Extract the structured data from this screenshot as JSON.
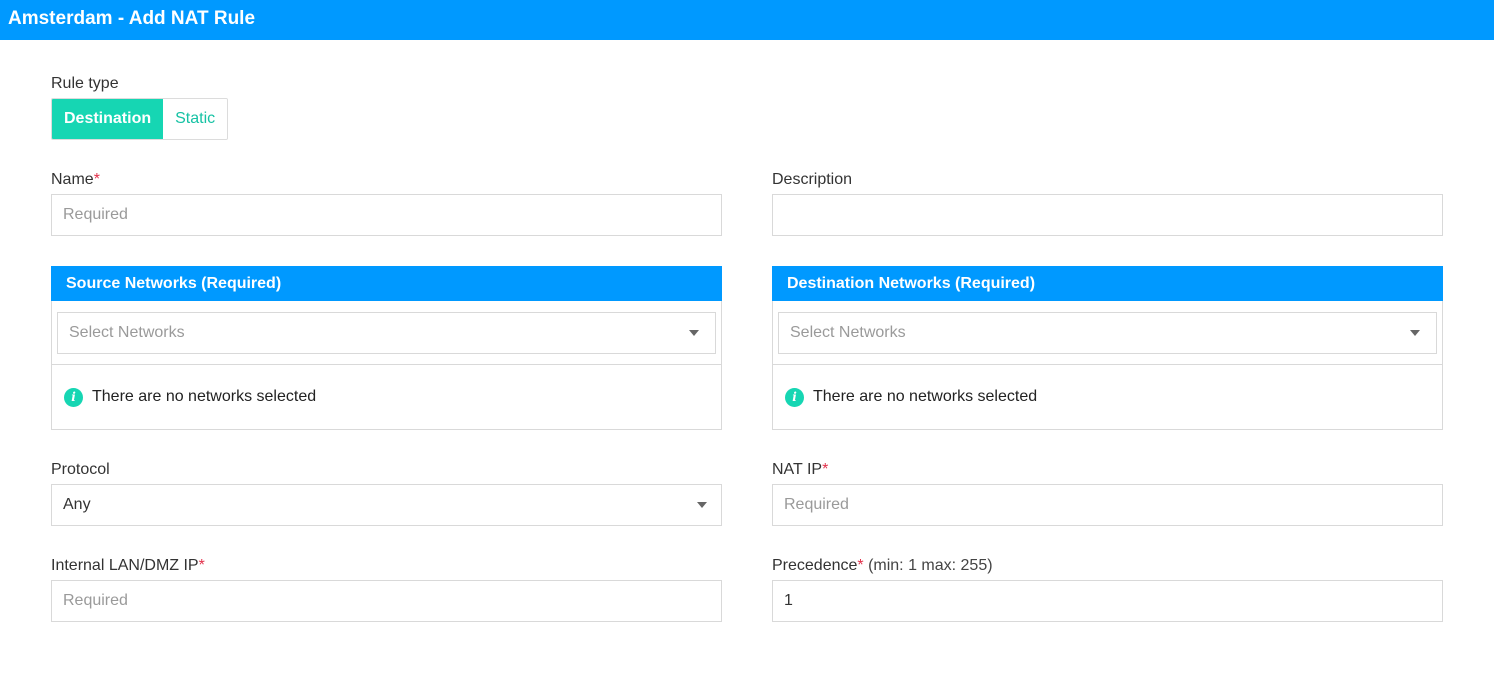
{
  "window": {
    "title": "Amsterdam - Add NAT Rule"
  },
  "rule_type": {
    "label": "Rule type",
    "options": [
      "Destination",
      "Static"
    ],
    "selected": "Destination"
  },
  "name": {
    "label": "Name",
    "required_mark": "*",
    "placeholder": "Required",
    "value": ""
  },
  "description": {
    "label": "Description",
    "value": ""
  },
  "source_networks": {
    "title": "Source Networks (Required)",
    "select_placeholder": "Select Networks",
    "empty_message": "There are no networks selected"
  },
  "destination_networks": {
    "title": "Destination Networks (Required)",
    "select_placeholder": "Select Networks",
    "empty_message": "There are no networks selected"
  },
  "protocol": {
    "label": "Protocol",
    "value": "Any"
  },
  "nat_ip": {
    "label": "NAT IP",
    "required_mark": "*",
    "placeholder": "Required",
    "value": ""
  },
  "internal_ip": {
    "label": "Internal LAN/DMZ IP",
    "required_mark": "*",
    "placeholder": "Required",
    "value": ""
  },
  "precedence": {
    "label": "Precedence",
    "required_mark": "*",
    "hint": " (min: 1 max: 255)",
    "value": "1"
  },
  "colors": {
    "header": "#0099ff",
    "accent": "#16d6b3",
    "required": "#e2304a"
  }
}
